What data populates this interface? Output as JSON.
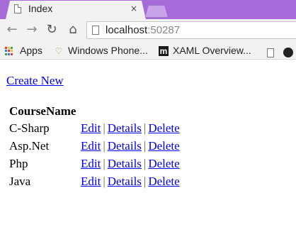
{
  "browser": {
    "tab": {
      "title": "Index",
      "close_glyph": "×"
    },
    "nav": {
      "back_icon": "back-arrow-icon",
      "forward_icon": "forward-arrow-icon",
      "reload_icon": "reload-icon",
      "home_icon": "home-icon"
    },
    "address": {
      "host": "localhost",
      "port": ":50287"
    },
    "bookmarks": [
      {
        "label": "Apps",
        "icon": "apps-grid-icon"
      },
      {
        "label": "Windows Phone...",
        "icon": "windows-phone-icon"
      },
      {
        "label": "XAML Overview...",
        "icon": "m-logo-icon"
      },
      {
        "label": "",
        "icon": "document-icon"
      },
      {
        "label": "",
        "icon": "extension-icon"
      }
    ]
  },
  "page": {
    "create_link": "Create New",
    "table": {
      "header": "CourseName",
      "rows": [
        {
          "name": "C-Sharp",
          "edit": "Edit",
          "details": "Details",
          "delete": "Delete"
        },
        {
          "name": "Asp.Net",
          "edit": "Edit",
          "details": "Details",
          "delete": "Delete"
        },
        {
          "name": "Php",
          "edit": "Edit",
          "details": "Details",
          "delete": "Delete"
        },
        {
          "name": "Java",
          "edit": "Edit",
          "details": "Details",
          "delete": "Delete"
        }
      ],
      "separator": "|"
    }
  },
  "colors": {
    "tabstrip": "#a66bd9",
    "link": "#0000ee",
    "toolbar": "#f2f2f2"
  }
}
